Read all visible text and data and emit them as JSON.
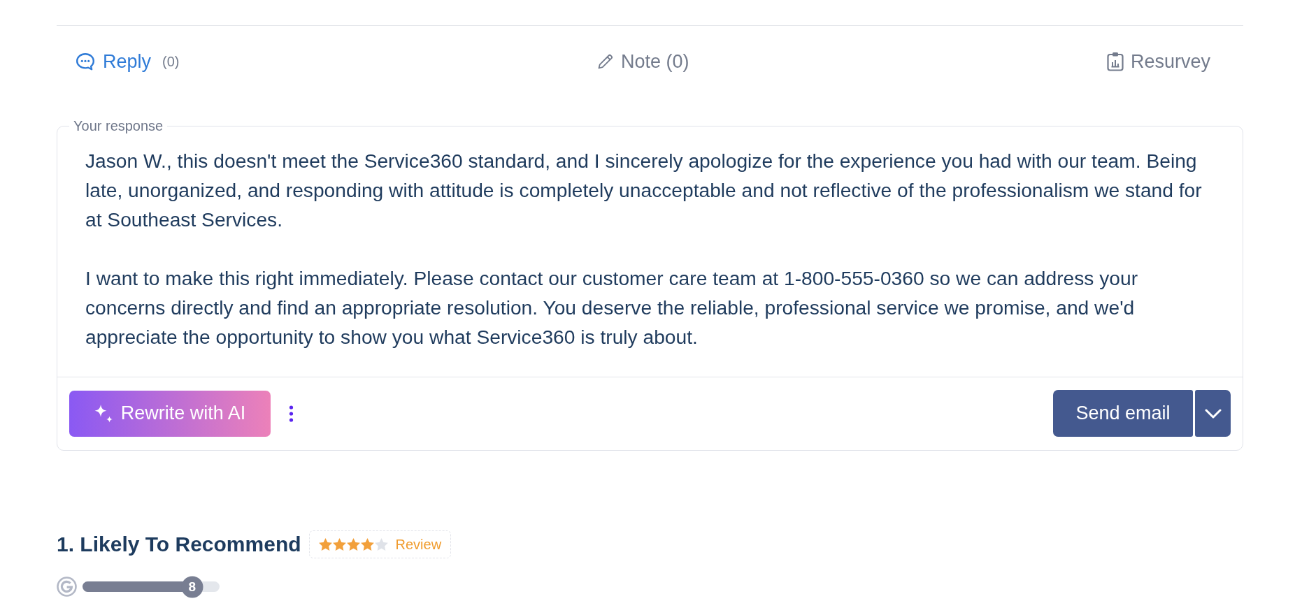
{
  "tabs": [
    {
      "label": "Reply",
      "count": "(0)",
      "selected": true
    },
    {
      "label": "Note (0)",
      "selected": false
    },
    {
      "label": "Resurvey",
      "selected": false
    }
  ],
  "response": {
    "label": "Your response",
    "paragraphs": [
      "Jason W., this doesn't meet the Service360 standard, and I sincerely apologize for the experience you had with our team. Being late, unorganized, and responding with attitude is completely unacceptable and not reflective of the professionalism we stand for at Southeast Services.",
      "I want to make this right immediately. Please contact our customer care team at 1-800-555-0360 so we can address your concerns directly and find an appropriate resolution. You deserve the reliable, professional service we promise, and we'd appreciate the opportunity to show you what Service360 is truly about."
    ]
  },
  "actions": {
    "rewrite_button": "Rewrite with AI",
    "send_button": "Send email"
  },
  "question": {
    "title": "1. Likely To Recommend",
    "stars": 4,
    "review_label": "Review",
    "score": {
      "level": 0.8,
      "reading": "8"
    }
  }
}
